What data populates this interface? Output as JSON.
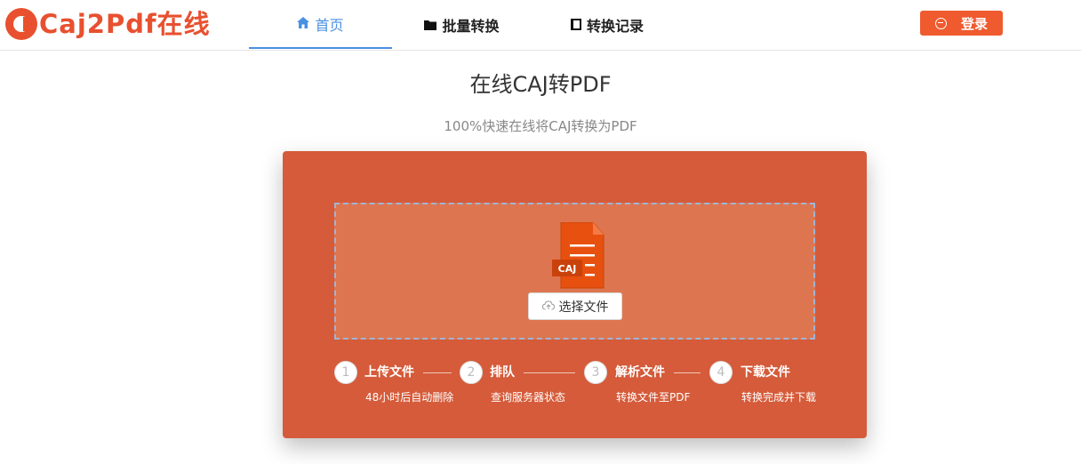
{
  "logo": {
    "text": "Caj2Pdf在线"
  },
  "nav": {
    "items": [
      {
        "label": "首页",
        "icon": "home-icon",
        "active": true
      },
      {
        "label": "批量转换",
        "icon": "folder-icon",
        "active": false
      },
      {
        "label": "转换记录",
        "icon": "book-icon",
        "active": false
      }
    ]
  },
  "login": {
    "label": "登录",
    "icon": "login-icon"
  },
  "page": {
    "title": "在线CAJ转PDF",
    "subtitle": "100%快速在线将CAJ转换为PDF"
  },
  "upload": {
    "file_badge": "CAJ",
    "choose_label": "选择文件"
  },
  "steps": [
    {
      "num": "1",
      "title": "上传文件",
      "desc": "48小时后自动删除"
    },
    {
      "num": "2",
      "title": "排队",
      "desc": "查询服务器状态"
    },
    {
      "num": "3",
      "title": "解析文件",
      "desc": "转换文件至PDF"
    },
    {
      "num": "4",
      "title": "下载文件",
      "desc": "转换完成并下载"
    }
  ],
  "colors": {
    "brand": "#e8502f",
    "panel": "#d55b3a",
    "nav_active": "#4a90e2",
    "login": "#ef5a2e"
  }
}
